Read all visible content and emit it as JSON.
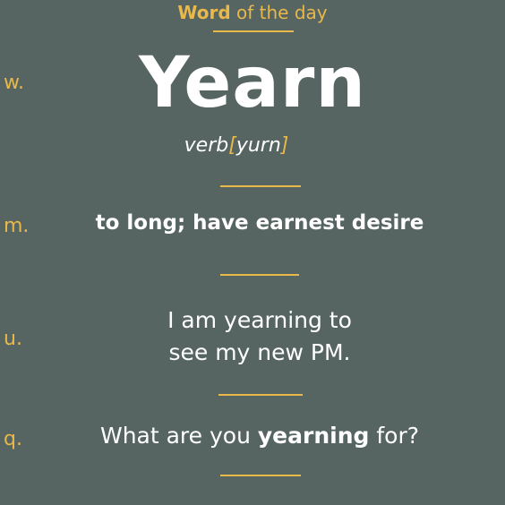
{
  "header": {
    "bold": "Word",
    "rest": " of the day"
  },
  "word": "Yearn",
  "part_of_speech": "verb",
  "pronunciation": {
    "open": "[",
    "text": "yurn",
    "close": "]"
  },
  "meaning": "to long; have earnest desire",
  "usage": {
    "line1": "I am yearning to",
    "line2": "see my new PM."
  },
  "question": {
    "before": "What are you ",
    "bold": "yearning",
    "after": " for?"
  },
  "side_labels": {
    "w": "w.",
    "m": "m.",
    "u": "u.",
    "q": "q."
  },
  "colors": {
    "background": "#566462",
    "accent": "#e8b84a",
    "text": "#ffffff"
  }
}
